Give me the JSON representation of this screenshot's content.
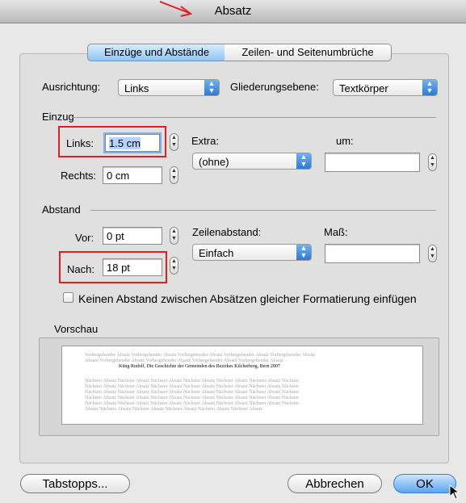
{
  "window": {
    "title": "Absatz"
  },
  "tabs": [
    {
      "label": "Einzüge und Abstände",
      "selected": true
    },
    {
      "label": "Zeilen- und Seitenumbrüche",
      "selected": false
    }
  ],
  "general": {
    "alignment_label": "Ausrichtung:",
    "alignment_value": "Links",
    "outline_label": "Gliederungsebene:",
    "outline_value": "Textkörper"
  },
  "indent": {
    "section_label": "Einzug",
    "left_label": "Links:",
    "left_value": "1.5 cm",
    "right_label": "Rechts:",
    "right_value": "0 cm",
    "special_label": "Extra:",
    "special_value": "(ohne)",
    "by_label": "um:",
    "by_value": ""
  },
  "spacing": {
    "section_label": "Abstand",
    "before_label": "Vor:",
    "before_value": "0 pt",
    "after_label": "Nach:",
    "after_value": "18 pt",
    "line_spacing_label": "Zeilenabstand:",
    "line_spacing_value": "Einfach",
    "at_label": "Maß:",
    "at_value": "",
    "no_space_checkbox_label": "Keinen Abstand zwischen Absätzen gleicher Formatierung einfügen",
    "no_space_checked": false
  },
  "preview": {
    "label": "Vorschau",
    "previous_text_1": "Vorhergehender Absatz Vorhergehender Absatz Vorhergehender Absatz Vorhergehender Absatz Vorhergehender Absatz",
    "previous_text_2": "Absatz Vorhergehender Absatz Vorhergehender Absatz Vorhergehender Absatz Vorhergehender Absatz",
    "current_text": "Küng Rudolf, Die Geschichte der Gemeinden des Bezirkes Kilcherberg, Bern 2007",
    "next_text_1": "Nächster Absatz Nächster Absatz Nächster Absatz Nächster Absatz Nächster Absatz Nächster Absatz Nächster",
    "next_text_2": "Nächster Absatz Nächster Absatz Nächster Absatz Nächster Absatz Nächster Absatz Nächster Absatz Nächster",
    "next_text_3": "Nächster Absatz Nächster Absatz Nächster Absatz Nächster Absatz Nächster Absatz Nächster Absatz Nächster",
    "next_text_4": "Nächster Absatz Nächster Absatz Nächster Absatz Nächster Absatz Nächster Absatz Nächster Absatz Nächster",
    "next_text_5": "Nächster Absatz Nächster Absatz Nächster Absatz Nächster Absatz Nächster Absatz Nächster Absatz Nächster",
    "next_text_6": "Absatz Nächster Absatz Nächster Absatz Nächster Absatz Nächster Absatz Nächster Absatz"
  },
  "buttons": {
    "tabs_label": "Tabstopps...",
    "cancel_label": "Abbrechen",
    "ok_label": "OK"
  },
  "colors": {
    "annotation_red": "#e02020",
    "accent_blue": "#5aa4ef"
  },
  "icons": {
    "popup_arrows": "chevron-updown-icon",
    "stepper": "stepper-icon",
    "annotation_arrow": "red-arrow-icon",
    "mouse_cursor": "mouse-pointer-icon"
  }
}
